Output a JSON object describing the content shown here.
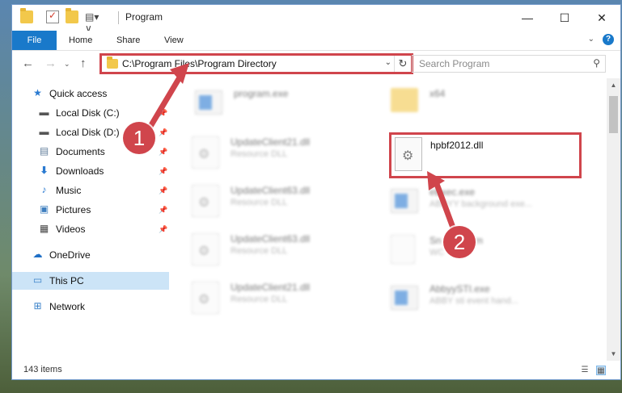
{
  "title_bar": {
    "title": "Program",
    "minimize_label": "—",
    "maximize_label": "☐",
    "close_label": "✕"
  },
  "ribbon": {
    "tabs": [
      "File",
      "Home",
      "Share",
      "View"
    ],
    "help_label": "?"
  },
  "address_bar": {
    "path": "C:\\Program Files\\Program Directory"
  },
  "search": {
    "placeholder": "Search Program"
  },
  "sidebar": {
    "items": [
      {
        "label": "Quick access",
        "icon": "star-icon",
        "pinned": false
      },
      {
        "label": "Local Disk (C:)",
        "icon": "drive-icon",
        "pinned": true
      },
      {
        "label": "Local Disk (D:)",
        "icon": "drive-icon",
        "pinned": true
      },
      {
        "label": "Documents",
        "icon": "document-icon",
        "pinned": true
      },
      {
        "label": "Downloads",
        "icon": "download-arrow-icon",
        "pinned": true
      },
      {
        "label": "Music",
        "icon": "music-note-icon",
        "pinned": true
      },
      {
        "label": "Pictures",
        "icon": "picture-icon",
        "pinned": true
      },
      {
        "label": "Videos",
        "icon": "film-icon",
        "pinned": true
      },
      {
        "label": "OneDrive",
        "icon": "cloud-icon",
        "pinned": false
      },
      {
        "label": "This PC",
        "icon": "monitor-icon",
        "pinned": false,
        "selected": true
      },
      {
        "label": "Network",
        "icon": "network-icon",
        "pinned": false
      }
    ]
  },
  "files": [
    {
      "name": "program.exe",
      "type": ""
    },
    {
      "name": "x64",
      "type": ""
    },
    {
      "name": "UpdateClient21.dll",
      "type": "Resource DLL"
    },
    {
      "name": "hpbf2012.dll",
      "type": ""
    },
    {
      "name": "UpdateClient63.dll",
      "type": "Resource DLL"
    },
    {
      "name": "eExec.exe",
      "type": "ABBYY background exe..."
    },
    {
      "name": "UpdateClient63.dll",
      "type": "Resource DLL"
    },
    {
      "name": "Sn 012.wcm",
      "type": "WC"
    },
    {
      "name": "UpdateClient21.dll",
      "type": "Resource DLL"
    },
    {
      "name": "AbbyySTI.exe",
      "type": "ABBY sti event hand..."
    }
  ],
  "status_bar": {
    "item_count": "143 items"
  },
  "annotations": {
    "step1": "1",
    "step2": "2"
  },
  "colors": {
    "highlight_red": "#d0454c",
    "file_tab_blue": "#1979ca",
    "selection_blue": "#cce4f7"
  }
}
